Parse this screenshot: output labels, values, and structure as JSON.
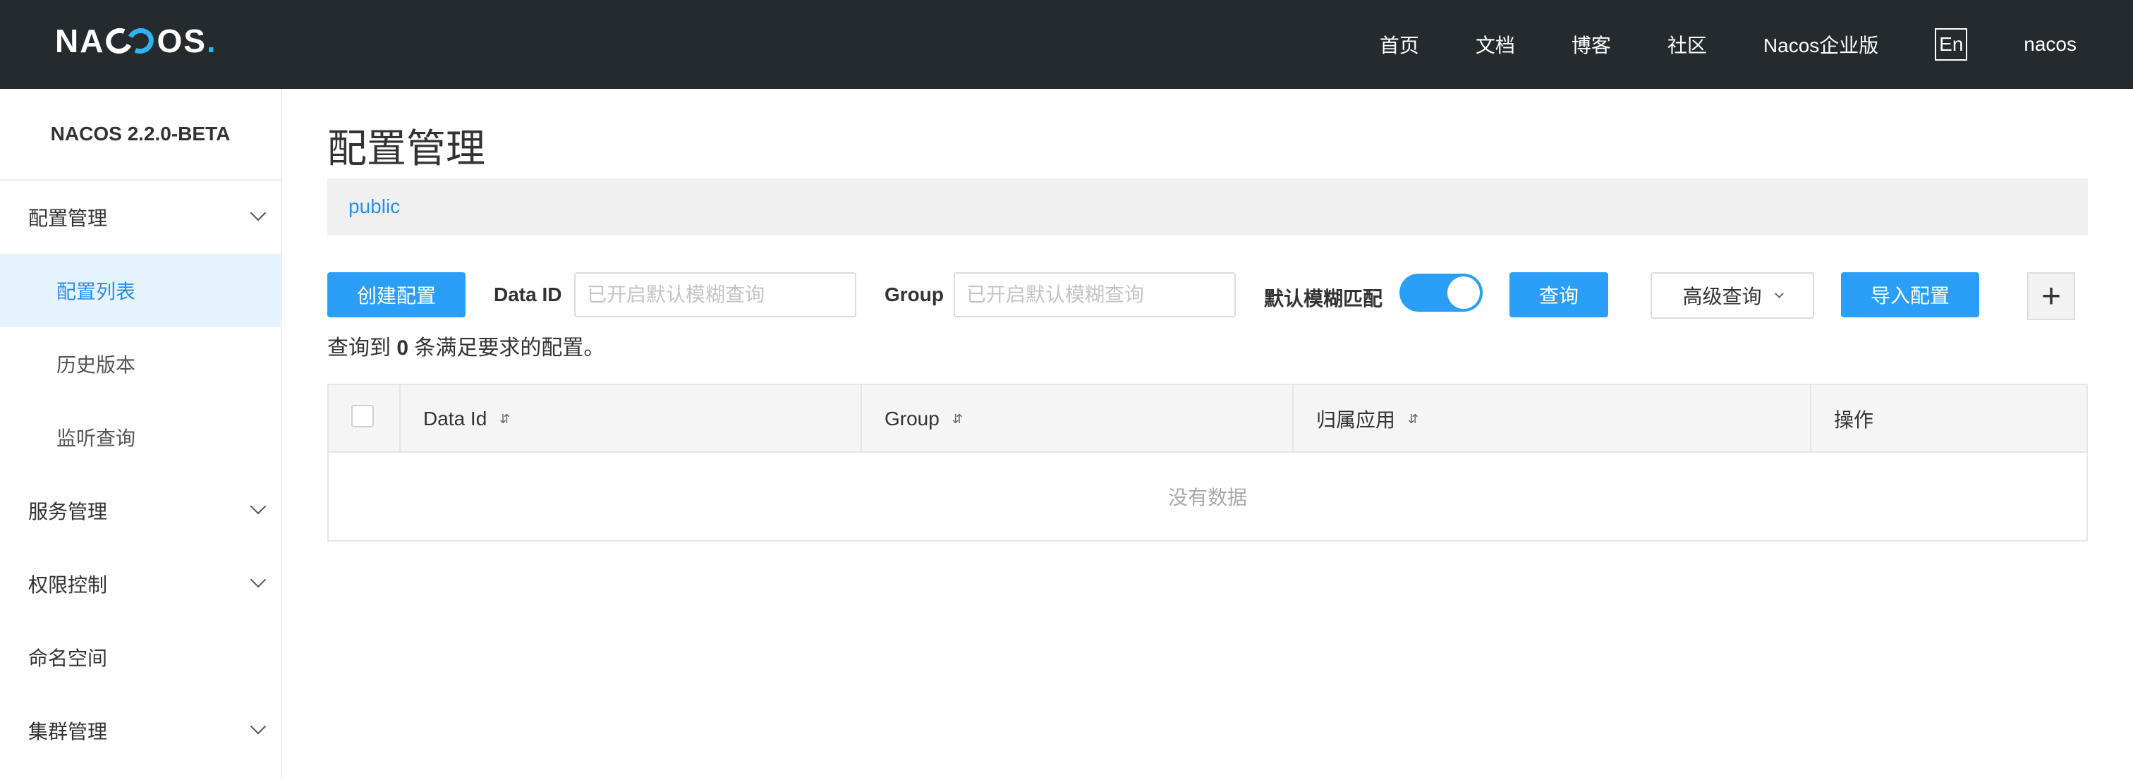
{
  "header": {
    "logo_text_1": "NA",
    "logo_text_2": "OS",
    "logo_dot": ".",
    "nav": [
      "首页",
      "文档",
      "博客",
      "社区",
      "Nacos企业版"
    ],
    "lang": "En",
    "user": "nacos"
  },
  "sidebar": {
    "version": "NACOS 2.2.0-BETA",
    "groups": {
      "config": "配置管理",
      "service": "服务管理",
      "auth": "权限控制",
      "namespace": "命名空间",
      "cluster": "集群管理"
    },
    "config_items": [
      "配置列表",
      "历史版本",
      "监听查询"
    ]
  },
  "main": {
    "title": "配置管理",
    "namespace": "public",
    "toolbar": {
      "create_label": "创建配置",
      "dataid_label": "Data ID",
      "dataid_placeholder": "已开启默认模糊查询",
      "group_label": "Group",
      "group_placeholder": "已开启默认模糊查询",
      "fuzzy_label": "默认模糊匹配",
      "fuzzy_enabled": true,
      "search_label": "查询",
      "advanced_label": "高级查询",
      "import_label": "导入配置",
      "plus_label": "+"
    },
    "result": {
      "prefix": "查询到",
      "count": "0",
      "suffix": "条满足要求的配置。"
    },
    "table": {
      "columns": [
        "Data Id",
        "Group",
        "归属应用",
        "操作"
      ],
      "sort_glyph": "⇵",
      "empty_text": "没有数据"
    }
  },
  "colors": {
    "header_bg": "#252a2f",
    "primary": "#2b9ff8",
    "link": "#2b8fe8",
    "active_bg": "#e5f3ff"
  }
}
